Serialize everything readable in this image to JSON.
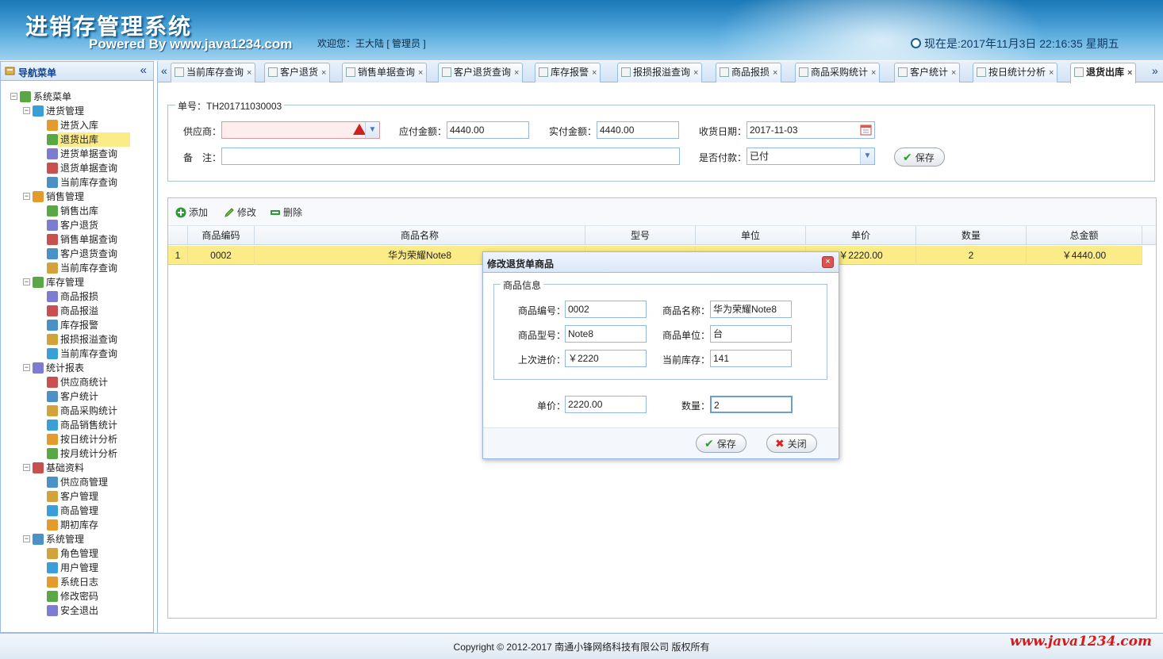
{
  "header": {
    "title": "进销存管理系统",
    "powered_by": "Powered By www.java1234.com",
    "welcome": "欢迎您：王大陆 [ 管理员 ]",
    "clock": "现在是:2017年11月3日 22:16:35 星期五"
  },
  "sidebar": {
    "title": "导航菜单",
    "collapse_icon": "«",
    "root": "系统菜单",
    "groups": [
      {
        "label": "进货管理",
        "items": [
          "进货入库",
          "退货出库",
          "进货单据查询",
          "退货单据查询",
          "当前库存查询"
        ]
      },
      {
        "label": "销售管理",
        "items": [
          "销售出库",
          "客户退货",
          "销售单据查询",
          "客户退货查询",
          "当前库存查询"
        ]
      },
      {
        "label": "库存管理",
        "items": [
          "商品报损",
          "商品报溢",
          "库存报警",
          "报损报溢查询",
          "当前库存查询"
        ]
      },
      {
        "label": "统计报表",
        "items": [
          "供应商统计",
          "客户统计",
          "商品采购统计",
          "商品销售统计",
          "按日统计分析",
          "按月统计分析"
        ]
      },
      {
        "label": "基础资料",
        "items": [
          "供应商管理",
          "客户管理",
          "商品管理",
          "期初库存"
        ]
      },
      {
        "label": "系统管理",
        "items": [
          "角色管理",
          "用户管理",
          "系统日志",
          "修改密码",
          "安全退出"
        ]
      }
    ],
    "selected": "退货出库"
  },
  "tabs": [
    {
      "label": "当前库存查询"
    },
    {
      "label": "客户退货"
    },
    {
      "label": "销售单据查询"
    },
    {
      "label": "客户退货查询"
    },
    {
      "label": "库存报警"
    },
    {
      "label": "报损报溢查询"
    },
    {
      "label": "商品报损"
    },
    {
      "label": "商品采购统计"
    },
    {
      "label": "客户统计"
    },
    {
      "label": "按日统计分析"
    },
    {
      "label": "退货出库",
      "active": true
    }
  ],
  "tab_close": "×",
  "tab_scroll_left": "«",
  "tab_scroll_right": "»",
  "form": {
    "order_no": "单号：TH201711030003",
    "supplier_label": "供应商：",
    "supplier_value": "",
    "payable_label": "应付金额：",
    "payable_value": "4440.00",
    "paid_label": "实付金额：",
    "paid_value": "4440.00",
    "date_label": "收货日期：",
    "date_value": "2017-11-03",
    "remark_label": "备　注：",
    "remark_value": "",
    "paid_status_label": "是否付款：",
    "paid_status_value": "已付",
    "save_button": "保存"
  },
  "toolbar": {
    "add": "添加",
    "edit": "修改",
    "delete": "删除"
  },
  "grid": {
    "columns": [
      "商品编码",
      "商品名称",
      "型号",
      "单位",
      "单价",
      "数量",
      "总金额"
    ],
    "rows": [
      {
        "index": "1",
        "code": "0002",
        "name": "华为荣耀Note8",
        "model": "",
        "unit": "",
        "price": "￥2220.00",
        "qty": "2",
        "total": "￥4440.00"
      }
    ]
  },
  "dialog": {
    "title": "修改退货单商品",
    "close_icon": "×",
    "fieldset_legend": "商品信息",
    "code_label": "商品编号：",
    "code_value": "0002",
    "name_label": "商品名称：",
    "name_value": "华为荣耀Note8",
    "model_label": "商品型号：",
    "model_value": "Note8",
    "unit_label": "商品单位：",
    "unit_value": "台",
    "last_price_label": "上次进价：",
    "last_price_value": "￥2220",
    "stock_label": "当前库存：",
    "stock_value": "141",
    "price_label": "单价：",
    "price_value": "2220.00",
    "qty_label": "数量：",
    "qty_value": "2",
    "save_button": "保存",
    "close_button": "关闭"
  },
  "footer": {
    "copyright": "Copyright © 2012-2017 南通小锋网络科技有限公司 版权所有",
    "brand_url": "www.java1234.com"
  },
  "colors": {
    "header_blue": "#3d96cf",
    "selection_yellow": "#fbec88",
    "border_blue": "#99bbe8",
    "brand_red": "#d61a1a"
  }
}
